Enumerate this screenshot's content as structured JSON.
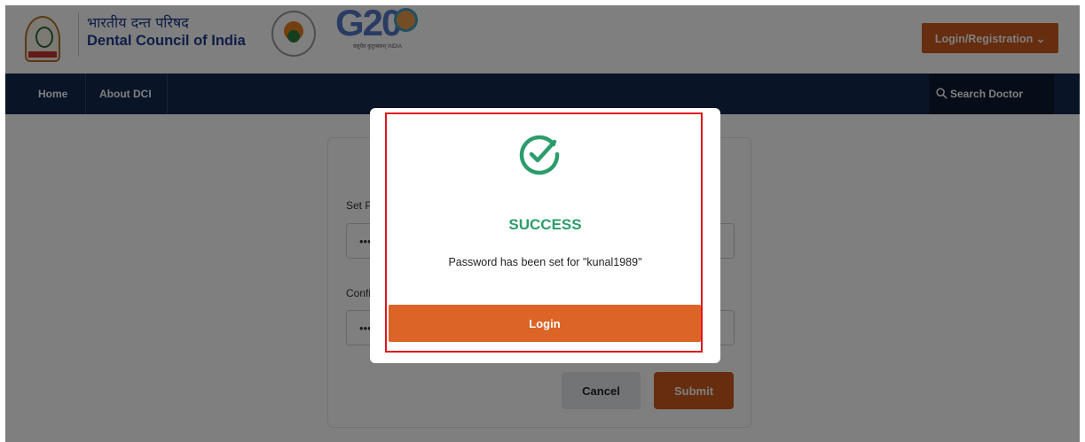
{
  "header": {
    "brand_hindi": "भारतीय दन्त परिषद",
    "brand_english": "Dental Council of India",
    "g20_logo_text": "G20",
    "g20_caption": "वसुधैव कुटुम्बकम् INDIA",
    "login_registration_label": "Login/Registration ⌄"
  },
  "nav": {
    "home_label": "Home",
    "about_label": "About DCI",
    "search_doctor_label": "Search Doctor"
  },
  "form": {
    "set_password_label": "Set Password",
    "set_password_value": "•••",
    "confirm_password_label": "Confirm Password",
    "confirm_password_value": "•••",
    "cancel_label": "Cancel",
    "submit_label": "Submit"
  },
  "modal": {
    "title": "SUCCESS",
    "message": "Password has been set for \"kunal1989\"",
    "login_label": "Login"
  },
  "colors": {
    "accent_orange": "#cc5a1c",
    "nav_navy": "#13284f",
    "success_green": "#2c9d6a",
    "highlight_red": "#e0131d"
  }
}
